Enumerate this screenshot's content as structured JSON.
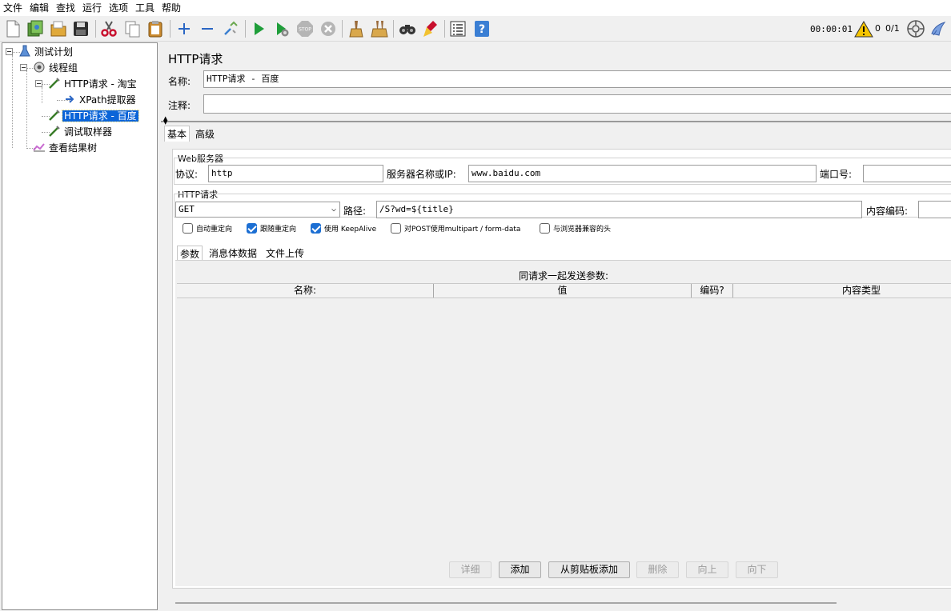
{
  "menu": [
    "文件",
    "编辑",
    "查找",
    "运行",
    "选项",
    "工具",
    "帮助"
  ],
  "toolbar": {
    "icons": [
      "new-icon",
      "templates-icon",
      "open-icon",
      "save-icon",
      "cut-icon",
      "copy-icon",
      "paste-icon",
      "expand-icon",
      "collapse-icon",
      "toggle-icon",
      "start-icon",
      "start-no-pause-icon",
      "stop-icon",
      "shutdown-icon",
      "clear-icon",
      "clear-all-icon",
      "search-icon",
      "reset-search-icon",
      "function-helper-icon",
      "help-icon"
    ],
    "elapsed_time": "00:00:01",
    "warning_count": "0",
    "threads_active": "0/1"
  },
  "tree": [
    {
      "label": "测试计划",
      "icon": "test-plan-icon"
    },
    {
      "label": "线程组",
      "icon": "thread-group-icon"
    },
    {
      "label": "HTTP请求 - 淘宝",
      "icon": "sampler-icon"
    },
    {
      "label": "XPath提取器",
      "icon": "extractor-icon"
    },
    {
      "label": "HTTP请求 - 百度",
      "icon": "sampler-icon",
      "selected": true
    },
    {
      "label": "调试取样器",
      "icon": "sampler-icon"
    },
    {
      "label": "查看结果树",
      "icon": "listener-icon"
    }
  ],
  "form": {
    "title": "HTTP请求",
    "name_label": "名称:",
    "name_value": "HTTP请求 - 百度",
    "comment_label": "注释:",
    "comment_value": "",
    "tabs": [
      "基本",
      "高级"
    ],
    "web_server": {
      "title": "Web服务器",
      "protocol_label": "协议:",
      "protocol_value": "http",
      "server_label": "服务器名称或IP:",
      "server_value": "www.baidu.com",
      "port_label": "端口号:",
      "port_value": ""
    },
    "http_request": {
      "title": "HTTP请求",
      "method": "GET",
      "path_label": "路径:",
      "path_value": "/S?wd=${title}",
      "encoding_label": "内容编码:",
      "encoding_value": ""
    },
    "checkboxes": [
      {
        "label": "自动重定向",
        "checked": false
      },
      {
        "label": "跟随重定向",
        "checked": true
      },
      {
        "label": "使用 KeepAlive",
        "checked": true
      },
      {
        "label": "对POST使用multipart / form-data",
        "checked": false
      },
      {
        "label": "与浏览器兼容的头",
        "checked": false
      }
    ],
    "subtabs": [
      "参数",
      "消息体数据",
      "文件上传"
    ],
    "params_caption": "同请求一起发送参数:",
    "columns": [
      "名称:",
      "值",
      "编码?",
      "内容类型"
    ],
    "buttons": [
      {
        "label": "详细",
        "enabled": false
      },
      {
        "label": "添加",
        "enabled": true
      },
      {
        "label": "从剪贴板添加",
        "enabled": true
      },
      {
        "label": "删除",
        "enabled": false
      },
      {
        "label": "向上",
        "enabled": false
      },
      {
        "label": "向下",
        "enabled": false
      }
    ]
  }
}
